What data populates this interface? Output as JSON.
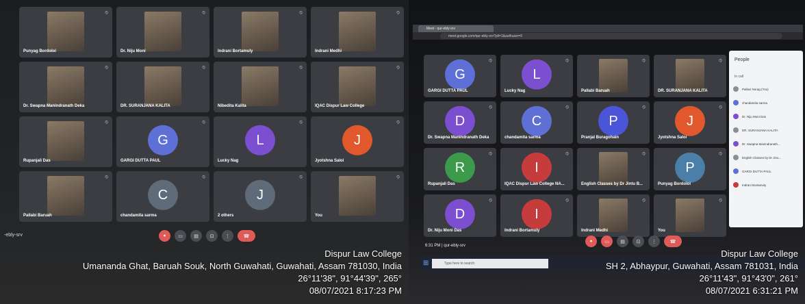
{
  "left": {
    "participants": [
      {
        "name": "Punyag Bordoloi"
      },
      {
        "name": "Dr. Niju Moni"
      },
      {
        "name": "Indrani Bortamuly"
      },
      {
        "name": "Indrani Medhi"
      },
      {
        "name": "Dr. Swapna Manindranath Deka"
      },
      {
        "name": "DR. SURANJANA KALITA"
      },
      {
        "name": "Nibedita Kalita"
      },
      {
        "name": "IQAC Dispur Law College"
      },
      {
        "name": "Rupanjali Das"
      },
      {
        "name": "GARGI DUTTA PAUL",
        "initial": "G",
        "color": "#5e6fd6"
      },
      {
        "name": "Lucky Nag",
        "initial": "L",
        "color": "#7b4fd0"
      },
      {
        "name": "Jyotshna Saloi",
        "initial": "J",
        "color": "#e2582d"
      },
      {
        "name": "Pallabi Baruah"
      },
      {
        "name": "chandamita sarma",
        "initial": "C",
        "color": "#5f6b78"
      },
      {
        "name": "2 others",
        "initial": "J",
        "color": "#5f6b78"
      },
      {
        "name": "You"
      }
    ],
    "meeting_code": "-ebly-srv",
    "stamp": {
      "line1": "Dispur Law College",
      "line2": "Umananda Ghat, Baruah Souk, North Guwahati, Guwahati, Assam 781030, India",
      "line3": "26°11'38\", 91°44'39\", 265°",
      "line4": "08/07/2021 8:17:23 PM"
    }
  },
  "right": {
    "tab_title": "Meet - qur-ebly-srv",
    "url": "meet.google.com/qur-ebly-srv?pli=1&authuser=0",
    "participants": [
      {
        "name": "GARGI DUTTA PAUL",
        "initial": "G",
        "color": "#5e6fd6"
      },
      {
        "name": "Lucky Nag",
        "initial": "L",
        "color": "#7b4fd0"
      },
      {
        "name": "Pallabi Baruah"
      },
      {
        "name": "DR. SURANJANA KALITA"
      },
      {
        "name": "Dr. Swapna Manindranath Deka",
        "initial": "D",
        "color": "#7b4fd0"
      },
      {
        "name": "chandamita sarma",
        "initial": "C",
        "color": "#5e6fd6"
      },
      {
        "name": "Pranjal Buragohain",
        "initial": "P",
        "color": "#4a55d8"
      },
      {
        "name": "Jyotshna Saloi",
        "initial": "J",
        "color": "#e2582d"
      },
      {
        "name": "Rupanjali Das",
        "initial": "R",
        "color": "#3d9a4a"
      },
      {
        "name": "IQAC Dispur Law College NA...",
        "initial": "I",
        "color": "#c63b3b"
      },
      {
        "name": "English Classes by Dr Jintu B..."
      },
      {
        "name": "Punyag Bordoloi",
        "initial": "P",
        "color": "#4a7fa8"
      },
      {
        "name": "Dr. Niju Moni Das",
        "initial": "D",
        "color": "#7b4fd0"
      },
      {
        "name": "Indrani Bortamuly",
        "initial": "I",
        "color": "#c63b3b"
      },
      {
        "name": "Indrani Medhi"
      },
      {
        "name": "You"
      }
    ],
    "people_panel": {
      "title": "People",
      "in_call": "In call",
      "list": [
        {
          "name": "Pallavi Norag (You)",
          "color": "#8a8f96"
        },
        {
          "name": "chandamita sarma",
          "color": "#5e6fd6"
        },
        {
          "name": "Dr. Niju Moni Das",
          "color": "#7b4fd0"
        },
        {
          "name": "DR. SURANJANA KALITA",
          "color": "#8a8f96"
        },
        {
          "name": "Dr. Swapna Manindranath...",
          "color": "#7b4fd0"
        },
        {
          "name": "English Classes by Dr Jinu...",
          "color": "#8a8f96"
        },
        {
          "name": "GARGI DUTTA PAUL",
          "color": "#5e6fd6"
        },
        {
          "name": "Indrani Bortamuly",
          "color": "#c63b3b"
        }
      ]
    },
    "meeting_info": "6:31 PM | qur-ebly-srv",
    "taskbar_search": "Type here to search",
    "stamp": {
      "line1": "Dispur Law College",
      "line2": "SH 2, Abhaypur, Guwahati, Assam 781031, India",
      "line3": "26°11'43\", 91°43'0\", 261°",
      "line4": "08/07/2021 6:31:21 PM"
    }
  }
}
